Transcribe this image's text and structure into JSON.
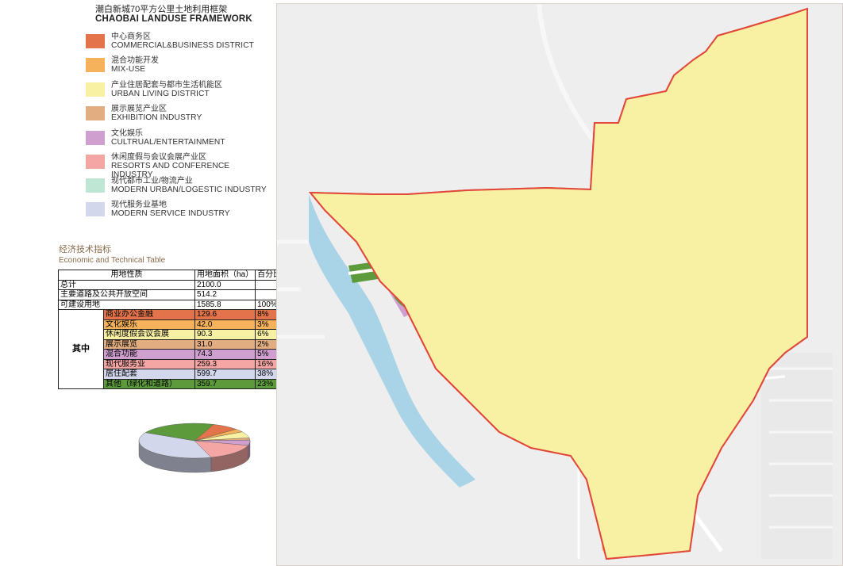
{
  "legend": {
    "title_cn": "潮白新城70平方公里土地利用框架",
    "title_en": "CHAOBAI LANDUSE FRAMEWORK",
    "items": [
      {
        "cn": "中心商务区",
        "en": "COMMERCIAL&BUSINESS DISTRICT",
        "color": "#e2734b"
      },
      {
        "cn": "混合功能开发",
        "en": "MIX-USE",
        "color": "#f5b25a"
      },
      {
        "cn": "产业住居配套与都市生活机能区",
        "en": "URBAN LIVING DISTRICT",
        "color": "#f8f0a2"
      },
      {
        "cn": "展示展览产业区",
        "en": "EXHIBITION INDUSTRY",
        "color": "#e2ad80"
      },
      {
        "cn": "文化娱乐",
        "en": "CULTRUAL/ENTERTAINMENT",
        "color": "#cf9fd0"
      },
      {
        "cn": "休闲度假与会议会展产业区",
        "en": "RESORTS AND CONFERENCE INDUSTRY",
        "color": "#f4a6a4"
      },
      {
        "cn": "现代都市工业/物流产业",
        "en": "MODERN URBAN/LOGESTIC INDUSTRY",
        "color": "#bfe6d4"
      },
      {
        "cn": "现代服务业基地",
        "en": "MODERN SERVICE INDUSTRY",
        "color": "#d3d7ec"
      }
    ]
  },
  "table": {
    "heading_cn": "经济技术指标",
    "heading_en": "Economic and Technical Table",
    "header": [
      "用地性质",
      "用地面积（ha）",
      "百分比"
    ],
    "rows": [
      {
        "label": "总计",
        "area": "2100.0",
        "pct": ""
      },
      {
        "label": "主要道路及公共开放空间",
        "area": "514.2",
        "pct": ""
      },
      {
        "label": "可建设用地",
        "area": "1585.8",
        "pct": "100%"
      }
    ],
    "group_label": "其中",
    "sub_rows": [
      {
        "label": "商业办公金融",
        "area": "129.6",
        "pct": "8%",
        "color": "#e2734b"
      },
      {
        "label": "文化娱乐",
        "area": "42.0",
        "pct": "3%",
        "color": "#f5b25a"
      },
      {
        "label": "休闲度假会议会展",
        "area": "90.3",
        "pct": "6%",
        "color": "#f8f0a2"
      },
      {
        "label": "展示展览",
        "area": "31.0",
        "pct": "2%",
        "color": "#e2ad80"
      },
      {
        "label": "混合功能",
        "area": "74.3",
        "pct": "5%",
        "color": "#cf9fd0"
      },
      {
        "label": "现代服务业",
        "area": "259.3",
        "pct": "16%",
        "color": "#f4a6a4"
      },
      {
        "label": "居住配套",
        "area": "599.7",
        "pct": "38%",
        "color": "#d3d7ec"
      },
      {
        "label": "其他（绿化和道路）",
        "area": "359.7",
        "pct": "23%",
        "color": "#5d9a3c"
      }
    ]
  },
  "pie": {
    "slices": [
      {
        "value": 8,
        "color": "#e2734b"
      },
      {
        "value": 3,
        "color": "#f5b25a"
      },
      {
        "value": 6,
        "color": "#f8f0a2"
      },
      {
        "value": 2,
        "color": "#e2ad80"
      },
      {
        "value": 5,
        "color": "#cf9fd0"
      },
      {
        "value": 16,
        "color": "#f4a6a4"
      },
      {
        "value": 38,
        "color": "#d3d7ec"
      },
      {
        "value": 23,
        "color": "#5d9a3c"
      }
    ]
  },
  "map": {
    "colors": {
      "boundary": "#e2483a",
      "green": "#5d9a3c",
      "river": "#a9d3e6",
      "road": "#ffffff",
      "background": "#eeeeee"
    }
  }
}
